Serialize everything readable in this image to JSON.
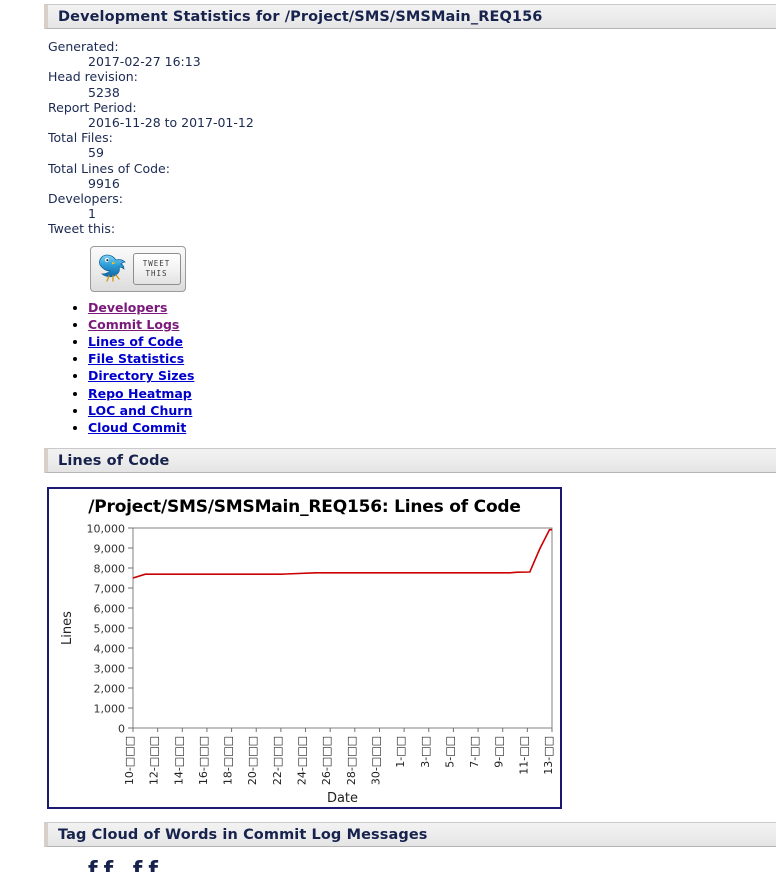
{
  "page": {
    "title": "Development Statistics for /Project/SMS/SMSMain_REQ156"
  },
  "summary": {
    "generated_label": "Generated:",
    "generated_value": "2017-02-27 16:13",
    "head_revision_label": "Head revision:",
    "head_revision_value": "5238",
    "report_period_label": "Report Period:",
    "report_period_value": "2016-11-28 to 2017-01-12",
    "total_files_label": "Total Files:",
    "total_files_value": "59",
    "total_loc_label": "Total Lines of Code:",
    "total_loc_value": "9916",
    "developers_label": "Developers:",
    "developers_value": "1",
    "tweet_label": "Tweet this:"
  },
  "tweet_button": {
    "line1": "TWEET",
    "line2": "THIS",
    "icon": "twitter-bird-icon"
  },
  "nav": {
    "items": [
      {
        "label": "Developers",
        "state": "visited"
      },
      {
        "label": "Commit Logs",
        "state": "visited"
      },
      {
        "label": "Lines of Code",
        "state": "unvisited"
      },
      {
        "label": "File Statistics",
        "state": "unvisited"
      },
      {
        "label": "Directory Sizes",
        "state": "unvisited"
      },
      {
        "label": "Repo Heatmap",
        "state": "unvisited"
      },
      {
        "label": "LOC and Churn",
        "state": "unvisited"
      },
      {
        "label": "Cloud Commit",
        "state": "unvisited"
      }
    ]
  },
  "sections": {
    "lines_of_code": "Lines of Code",
    "tag_cloud": "Tag Cloud of Words in Commit Log Messages"
  },
  "colors": {
    "series_red": "#cc0000",
    "chart_border": "#191970",
    "heading": "#17234d",
    "link_blue": "#0000cc",
    "link_visited": "#7b187b"
  },
  "chart_data": {
    "type": "line",
    "title": "/Project/SMS/SMSMain_REQ156: Lines of Code",
    "xlabel": "Date",
    "ylabel": "Lines",
    "ylim": [
      0,
      10000
    ],
    "ytick_step": 1000,
    "yticks": [
      "0",
      "1,000",
      "2,000",
      "3,000",
      "4,000",
      "5,000",
      "6,000",
      "7,000",
      "8,000",
      "9,000",
      "10,000"
    ],
    "grid": false,
    "legend": false,
    "xtick_labels": [
      "10-□□□",
      "12-□□□",
      "14-□□□",
      "16-□□□",
      "18-□□□",
      "20-□□□",
      "22-□□□",
      "24-□□□",
      "26-□□□",
      "28-□□□",
      "30-□□□",
      "1-□□",
      "3-□□",
      "5-□□",
      "7-□□",
      "9-□□",
      "11-□□",
      "13-□□"
    ],
    "series": [
      {
        "name": "Lines of Code",
        "color": "#cc0000",
        "x": [
          0.0,
          0.5,
          6.0,
          6.2,
          7.4,
          15.3,
          15.6,
          16.1,
          16.5,
          16.9,
          17.0
        ],
        "values": [
          7500,
          7690,
          7690,
          7700,
          7760,
          7760,
          7790,
          7800,
          8950,
          9916,
          9916
        ]
      }
    ]
  }
}
